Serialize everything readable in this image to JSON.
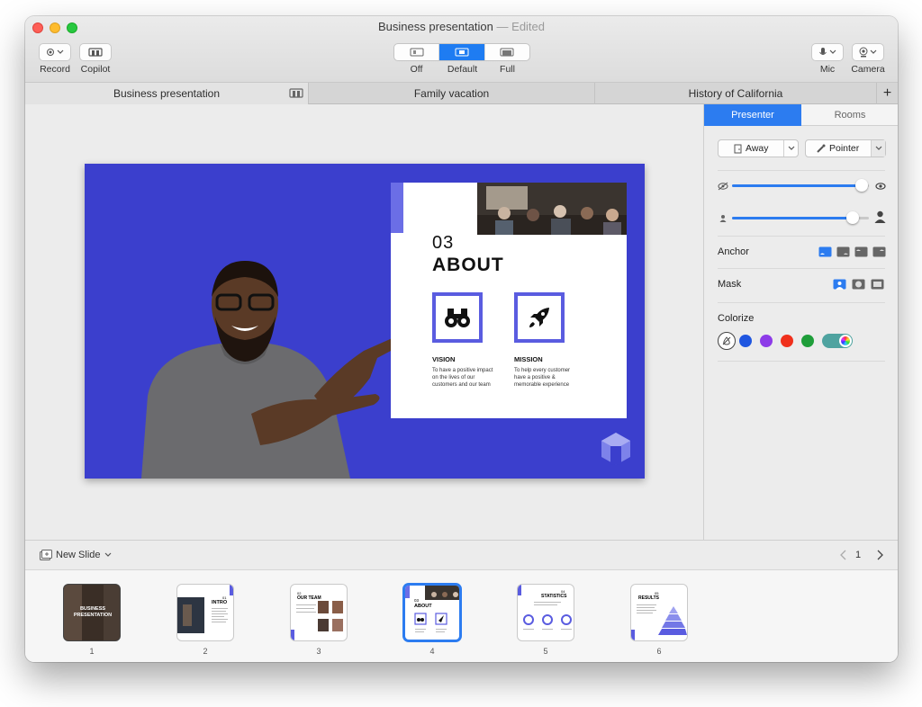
{
  "window": {
    "title": "Business presentation",
    "edited_suffix": "— Edited"
  },
  "toolbar": {
    "record_label": "Record",
    "copilot_label": "Copilot",
    "view_modes": [
      {
        "label": "Off"
      },
      {
        "label": "Default"
      },
      {
        "label": "Full"
      }
    ],
    "mic_label": "Mic",
    "camera_label": "Camera"
  },
  "tabs": [
    {
      "label": "Business presentation"
    },
    {
      "label": "Family vacation"
    },
    {
      "label": "History of California"
    }
  ],
  "slide": {
    "number": "03",
    "heading": "ABOUT",
    "vision": {
      "title": "VISION",
      "text": "To have a positive impact on the lives of our customers and our team"
    },
    "mission": {
      "title": "MISSION",
      "text": "To help every customer have a positive & memorable experience"
    }
  },
  "panel": {
    "tabs": [
      {
        "label": "Presenter"
      },
      {
        "label": "Rooms"
      }
    ],
    "away_label": "Away",
    "pointer_label": "Pointer",
    "anchor_label": "Anchor",
    "mask_label": "Mask",
    "colorize_label": "Colorize",
    "slider_opacity": 0.95,
    "slider_size": 0.88,
    "colors": [
      "#1f56e0",
      "#8d3be8",
      "#f0301c",
      "#1f9e3a"
    ],
    "accent": "#1e7cf2"
  },
  "bottom": {
    "new_slide_label": "New Slide",
    "page": "1"
  },
  "thumbnails": [
    {
      "num": "1",
      "title": "BUSINESS PRESENTATION"
    },
    {
      "num": "2",
      "title": "INTRO",
      "n": "01"
    },
    {
      "num": "3",
      "title": "OUR TEAM",
      "n": "02"
    },
    {
      "num": "4",
      "title": "ABOUT",
      "n": "03"
    },
    {
      "num": "5",
      "title": "STATISTICS",
      "n": "04"
    },
    {
      "num": "6",
      "title": "RESULTS",
      "n": "05"
    }
  ]
}
